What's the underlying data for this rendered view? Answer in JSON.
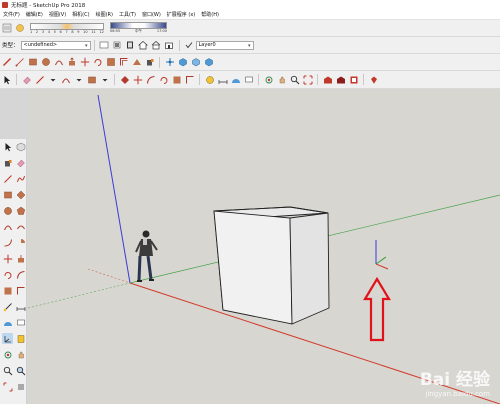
{
  "window": {
    "title": "无标题 - SketchUp Pro 2018"
  },
  "menu": [
    "文件(F)",
    "编辑(E)",
    "视图(V)",
    "相机(C)",
    "绘图(R)",
    "工具(T)",
    "窗口(W)",
    "扩展程序 (x)",
    "帮助(H)"
  ],
  "shadow": {
    "months": [
      "1",
      "2",
      "3",
      "4",
      "5",
      "6",
      "7",
      "8",
      "9",
      "10",
      "11",
      "12"
    ],
    "time_start": "06:55",
    "time_noon": "中午",
    "time_end": "17:00"
  },
  "row2": {
    "tag_label": "类型：",
    "material_value": "<undefined>",
    "layer_value": "Layer0"
  },
  "watermark": {
    "brand": "Bai 经验",
    "url": "jingyan.baidu.com"
  },
  "colors": {
    "axis_red": "#d23a2a",
    "axis_green": "#2f9a33",
    "axis_blue": "#3b3bd6",
    "arrow_red": "#e0121a",
    "bg": "#d7d6d1"
  }
}
